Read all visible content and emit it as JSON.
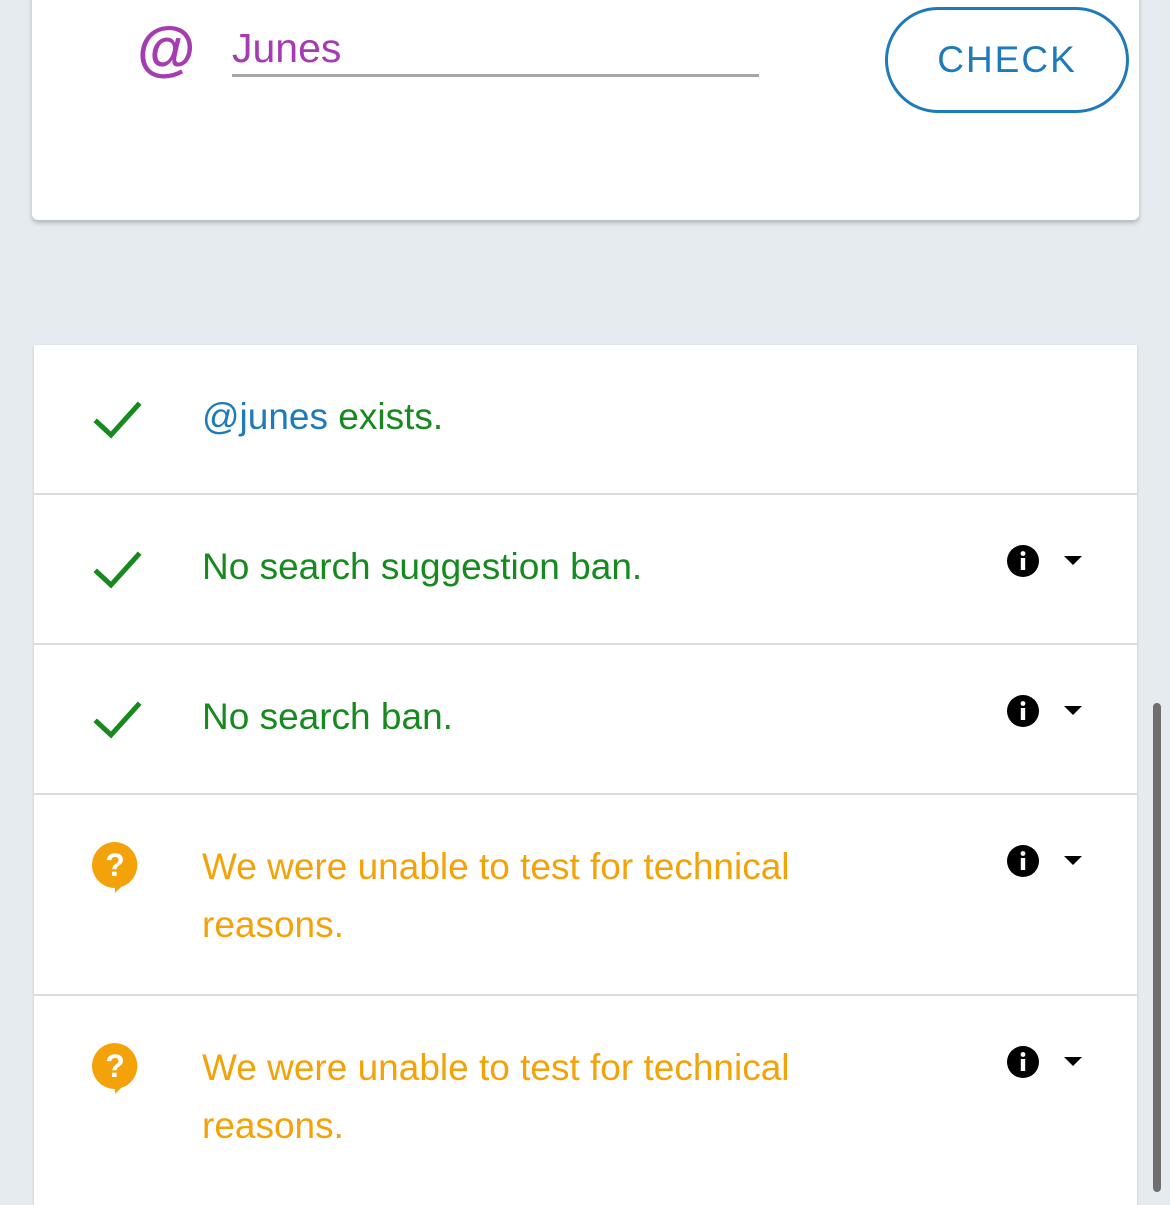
{
  "search": {
    "at_symbol": "@",
    "username_value": "Junes",
    "check_label": "CHECK"
  },
  "results": [
    {
      "status": "ok",
      "icon": "checkmark-icon",
      "handle": "@junes",
      "text": " exists.",
      "color": "#168a1e"
    },
    {
      "status": "ok",
      "icon": "checkmark-icon",
      "text": "No search suggestion ban.",
      "color": "#168a1e"
    },
    {
      "status": "ok",
      "icon": "checkmark-icon",
      "text": "No search ban.",
      "color": "#168a1e"
    },
    {
      "status": "unknown",
      "icon": "question-bubble-icon",
      "line1": "We were unable to test for technical",
      "line2": "reasons.",
      "color": "#f4a20a"
    },
    {
      "status": "unknown",
      "icon": "question-bubble-icon",
      "line1": "We were unable to test for technical",
      "line2": "reasons.",
      "color": "#f4a20a"
    }
  ],
  "colors": {
    "accent_purple": "#a63cb1",
    "link_blue": "#1e7ab8",
    "success_green": "#168a1e",
    "warning_orange": "#f4a20a",
    "background": "#e6ebef"
  }
}
